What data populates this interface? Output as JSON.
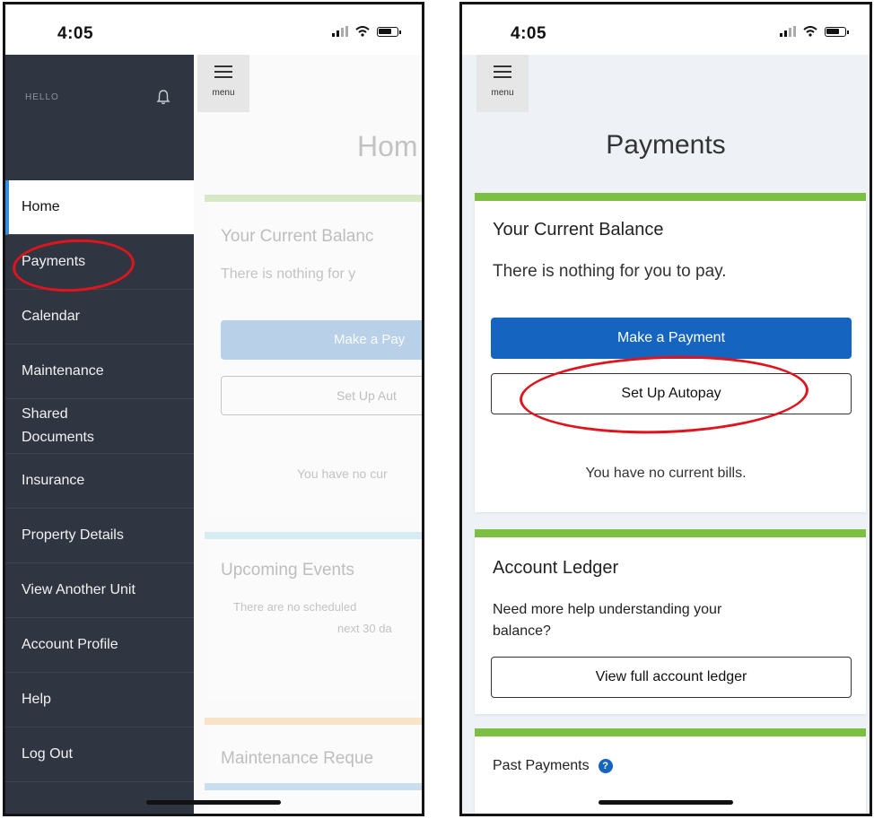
{
  "left_phone": {
    "status_bar": {
      "time": "4:05"
    },
    "drawer": {
      "greeting": "HELLO",
      "icon": "bell-icon",
      "items": [
        {
          "label": "Home",
          "active": true
        },
        {
          "label": "Payments",
          "active": false,
          "annotated": true
        },
        {
          "label": "Calendar",
          "active": false
        },
        {
          "label": "Maintenance",
          "active": false
        },
        {
          "label": "Shared Documents",
          "active": false
        },
        {
          "label": "Insurance",
          "active": false
        },
        {
          "label": "Property Details",
          "active": false
        },
        {
          "label": "View Another Unit",
          "active": false
        },
        {
          "label": "Account Profile",
          "active": false
        },
        {
          "label": "Help",
          "active": false
        },
        {
          "label": "Log Out",
          "active": false
        }
      ]
    },
    "background_page": {
      "menu_label": "menu",
      "title": "Hom",
      "balance_heading": "Your Current Balanc",
      "balance_text": "There is nothing for y",
      "pay_button": "Make a Pay",
      "autopay_button": "Set Up Aut",
      "no_bills": "You have no cur",
      "events_heading": "Upcoming Events",
      "events_text_1": "There are no scheduled",
      "events_text_2": "next 30 da",
      "maintenance_heading": "Maintenance Reque"
    }
  },
  "right_phone": {
    "status_bar": {
      "time": "4:05"
    },
    "menu_label": "menu",
    "page_title": "Payments",
    "balance_card": {
      "heading": "Your Current Balance",
      "text": "There is nothing for you to pay.",
      "pay_button": "Make a Payment",
      "autopay_button": "Set Up Autopay",
      "no_bills": "You have no current bills."
    },
    "ledger_card": {
      "heading": "Account Ledger",
      "help_text": "Need more help understanding your balance?",
      "ledger_button": "View full account ledger"
    },
    "past_payments": {
      "label": "Past Payments",
      "help_icon": "?"
    }
  },
  "colors": {
    "drawer_bg": "#2f3541",
    "primary_button": "#1565c0",
    "accent_green": "#7cc043",
    "annotation_red": "#e0141c"
  }
}
